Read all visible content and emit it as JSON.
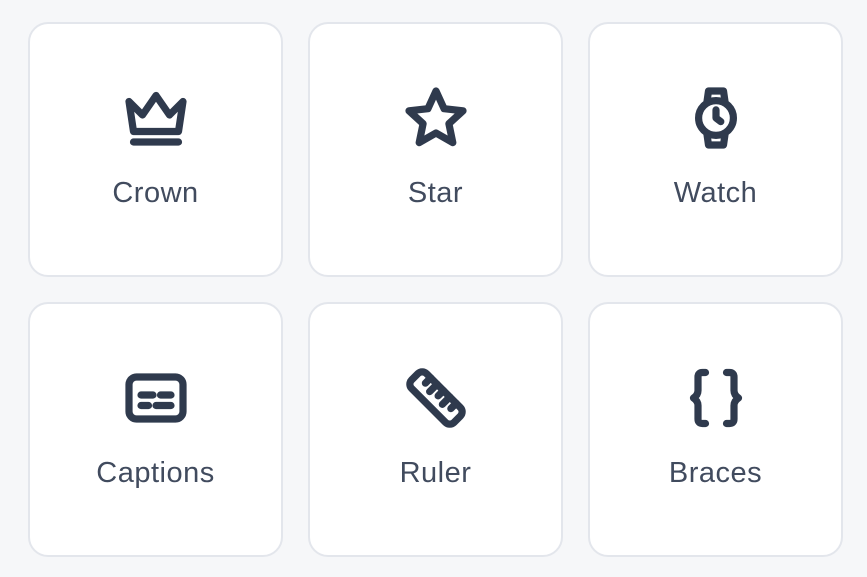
{
  "cards": [
    {
      "label": "Crown",
      "icon": "crown-icon"
    },
    {
      "label": "Star",
      "icon": "star-icon"
    },
    {
      "label": "Watch",
      "icon": "watch-icon"
    },
    {
      "label": "Captions",
      "icon": "captions-icon"
    },
    {
      "label": "Ruler",
      "icon": "ruler-icon"
    },
    {
      "label": "Braces",
      "icon": "braces-icon"
    }
  ],
  "colors": {
    "background": "#f6f7f9",
    "card": "#ffffff",
    "border": "#e3e6ec",
    "icon": "#2f3a4d",
    "label": "#414b5e"
  }
}
